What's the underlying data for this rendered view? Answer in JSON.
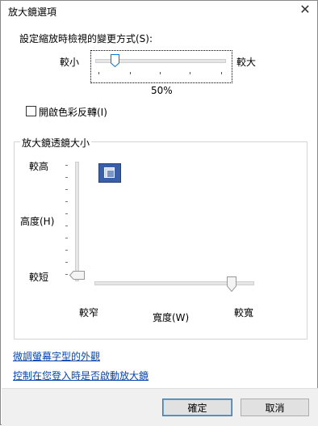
{
  "dialog": {
    "title": "放大鏡選項",
    "close_glyph": "✕"
  },
  "zoom": {
    "label": "設定縮放時檢視的變更方式(S):",
    "min_label": "較小",
    "max_label": "較大",
    "value_text": "50%",
    "value": 0.15
  },
  "invert": {
    "label": "開啟色彩反轉(I)",
    "checked": false
  },
  "lens": {
    "group_label": "放大鏡透鏡大小",
    "height_top": "較高",
    "height_label": "高度(H)",
    "height_bottom": "較短",
    "width_left": "較窄",
    "width_label": "寬度(W)",
    "width_right": "較寬",
    "height_value": 0.0,
    "width_value": 1.0
  },
  "links": {
    "adjust_text": "微調螢幕字型的外觀",
    "startup": "控制在您登入時是否啟動放大鏡"
  },
  "buttons": {
    "ok": "確定",
    "cancel": "取消"
  }
}
